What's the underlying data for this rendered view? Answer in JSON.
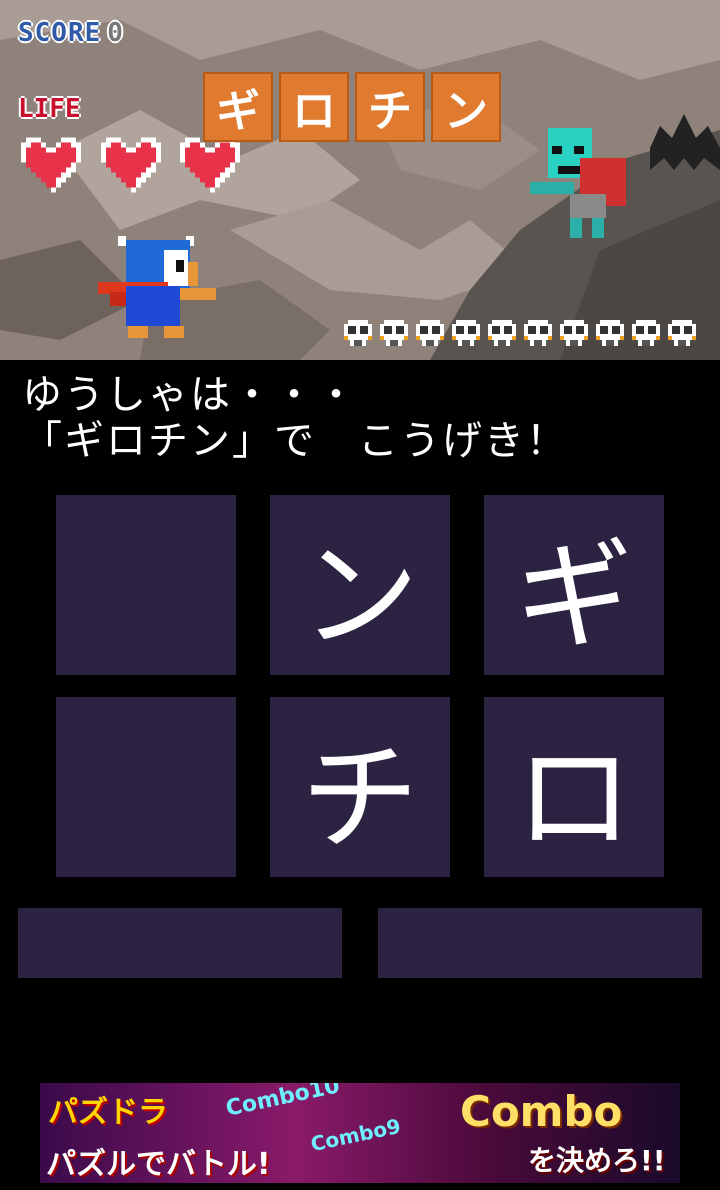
{
  "hud": {
    "score_label": "SCORE",
    "score_value": "0",
    "life_label": "LIFE",
    "lives": 3,
    "enemies_remaining": 10
  },
  "target_word": [
    "ギ",
    "ロ",
    "チ",
    "ン"
  ],
  "message": {
    "line1": "ゆうしゃは・・・",
    "line2": "「ギロチン」で　こうげき！"
  },
  "grid": [
    {
      "glyph": ""
    },
    {
      "glyph": "ン"
    },
    {
      "glyph": "ギ"
    },
    {
      "glyph": ""
    },
    {
      "glyph": "チ"
    },
    {
      "glyph": "ロ"
    }
  ],
  "ad": {
    "brand": "パズドラ",
    "tagline": "パズルでバトル!",
    "combo_10": "Combo10",
    "combo_9": "Combo9",
    "combo": "Combo",
    "call_to_action": "を決めろ!!"
  },
  "colors": {
    "tile_bg": "#2c2242",
    "word_tile": "#e07a2f",
    "heart": "#e8324a",
    "score_text": "#2f5aa8",
    "life_text": "#c8102e"
  },
  "icons": {
    "life": "heart-icon",
    "enemy_counter": "skull-icon"
  }
}
